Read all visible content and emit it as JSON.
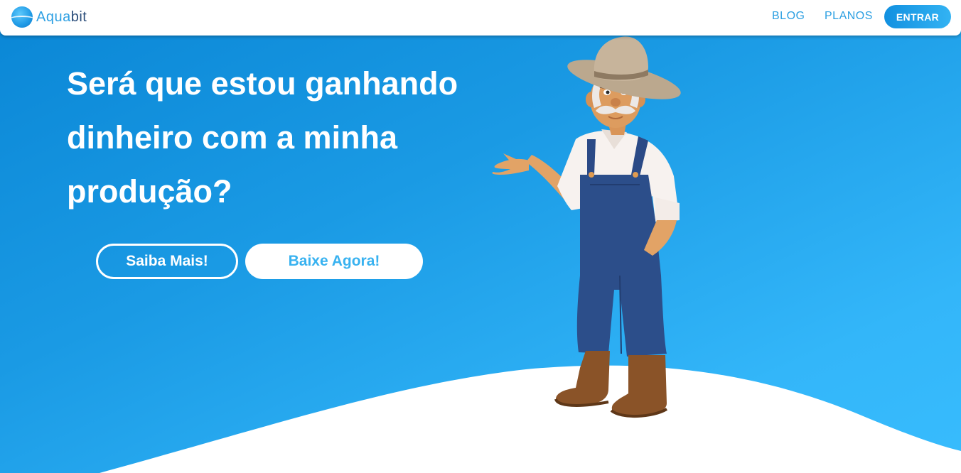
{
  "brand": {
    "name_part1": "Aqua",
    "name_part2": "bit"
  },
  "nav": {
    "blog": "BLOG",
    "planos": "PLANOS",
    "entrar": "ENTRAR"
  },
  "hero": {
    "headline_line1": "Será que estou ganhando",
    "headline_line2": "dinheiro com a minha",
    "headline_line3": "produção?",
    "saiba_mais": "Saiba Mais!",
    "baixe_agora": "Baixe Agora!"
  },
  "icons": {
    "logo": "water-drop-logo-icon",
    "illustration": "farmer-illustration"
  },
  "colors": {
    "primary": "#1f9ae6",
    "accent": "#38b2f0",
    "navy": "#2b4d7a",
    "white": "#ffffff"
  }
}
